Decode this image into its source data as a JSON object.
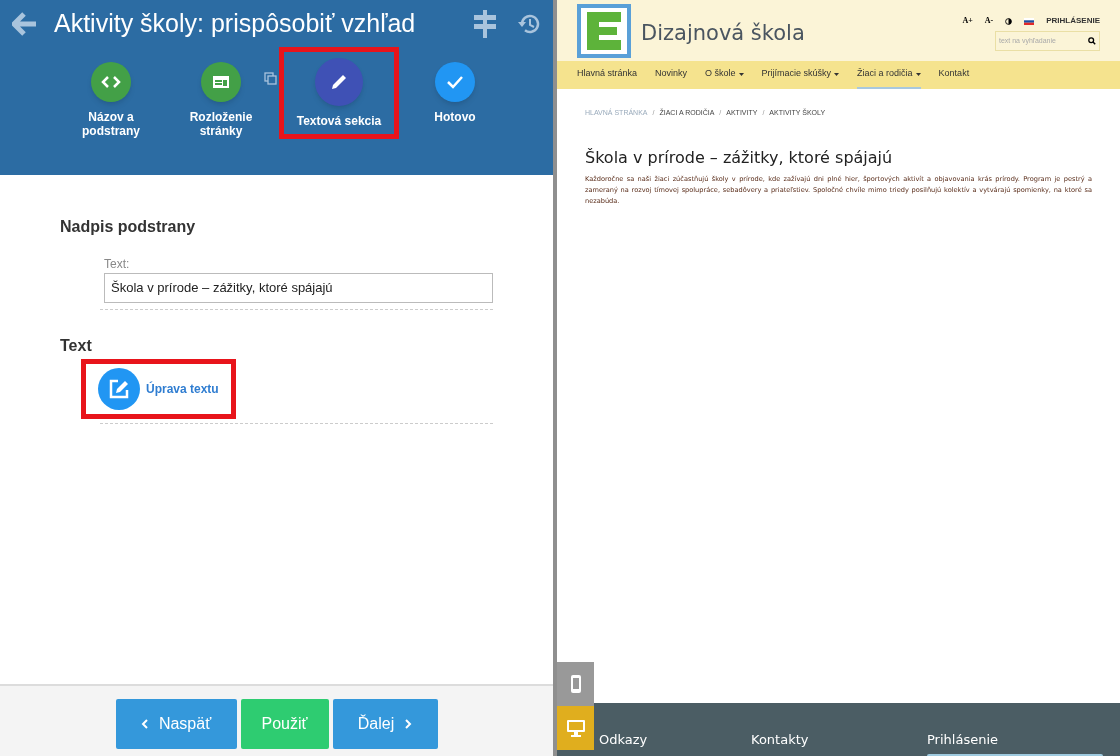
{
  "editor": {
    "title": "Aktivity školy: prispôsobiť vzhľad",
    "steps": [
      {
        "label": "Názov a podstrany",
        "kind": "code",
        "selected": false,
        "highlighted": false
      },
      {
        "label": "Rozloženie stránky",
        "kind": "layout",
        "selected": false,
        "highlighted": false
      },
      {
        "label": "Textová sekcia",
        "kind": "edit",
        "selected": true,
        "highlighted": true
      },
      {
        "label": "Hotovo",
        "kind": "done",
        "selected": false,
        "highlighted": false
      }
    ],
    "sections": [
      {
        "heading": "Nadpis podstrany",
        "kind": "field",
        "field_label": "Text:",
        "value": "Škola v prírode – zážitky, ktoré spájajú"
      },
      {
        "heading": "Text",
        "kind": "action",
        "action_label": "Úprava textu",
        "highlighted": true
      }
    ],
    "buttons": [
      {
        "label": "Naspäť",
        "kind": "back"
      },
      {
        "label": "Použiť",
        "kind": "apply"
      },
      {
        "label": "Ďalej",
        "kind": "next"
      }
    ]
  },
  "preview": {
    "site_name": "Dizajnová škola",
    "tools": [
      "A+",
      "A-"
    ],
    "login_link": "PRIHLÁSENIE",
    "search": {
      "placeholder": "text na vyhľadanie"
    },
    "nav": [
      {
        "label": "Hlavná stránka",
        "dropdown": false,
        "selected": false
      },
      {
        "label": "Novinky",
        "dropdown": false,
        "selected": false
      },
      {
        "label": "O škole",
        "dropdown": true,
        "selected": false
      },
      {
        "label": "Prijímacie skúšky",
        "dropdown": true,
        "selected": false
      },
      {
        "label": "Žiaci a rodičia",
        "dropdown": true,
        "selected": true
      },
      {
        "label": "Kontakt",
        "dropdown": false,
        "selected": false
      }
    ],
    "breadcrumb": [
      {
        "label": "HLAVNÁ STRÁNKA"
      },
      {
        "separator": "/",
        "label": "ŽIACI A RODIČIA"
      },
      {
        "separator": "/",
        "label": "AKTIVITY"
      },
      {
        "separator": "/",
        "label": "AKTIVITY ŠKOLY"
      }
    ],
    "heading": "Škola v prírode – zážitky, ktoré spájajú",
    "paragraph": "Každoročne sa naši žiaci zúčastňujú školy v prírode, kde zažívajú dni plné hier, športových aktivít a objavovania krás prírody. Program je pestrý a zameraný na rozvoj tímovej spolupráce, sebadôvery a priateľstiev. Spoločné chvíle mimo triedy posilňujú kolektív a vytvárajú spomienky, na ktoré sa nezabúda.",
    "footer": [
      "Odkazy",
      "Kontakty",
      "Prihlásenie"
    ],
    "devices": [
      {
        "kind": "mobile",
        "selected": false
      },
      {
        "kind": "desktop",
        "selected": true
      }
    ]
  }
}
